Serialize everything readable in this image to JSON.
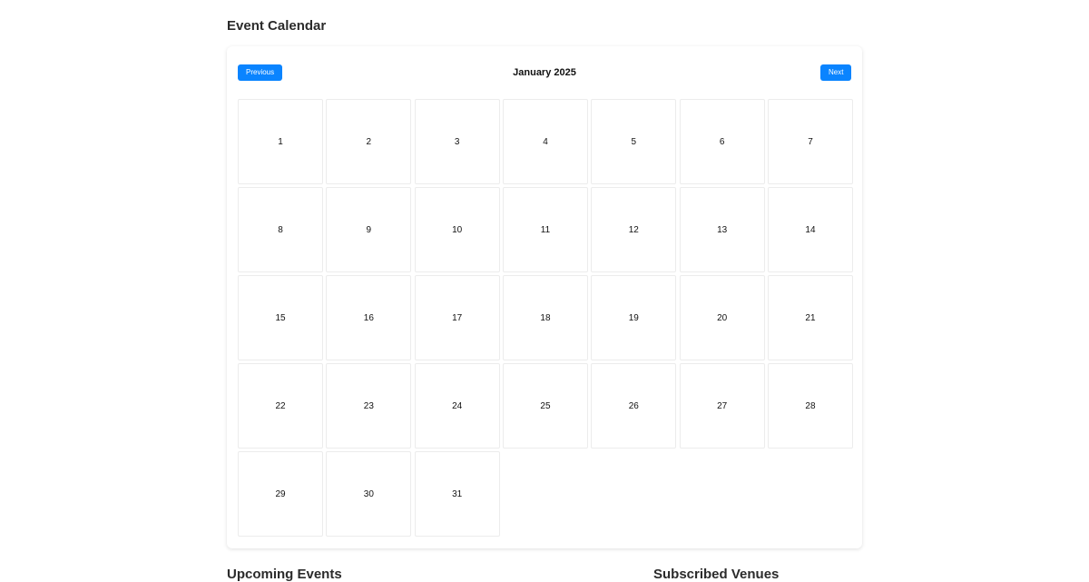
{
  "page": {
    "title": "Event Calendar"
  },
  "calendar": {
    "month_label": "January 2025",
    "prev_label": "Previous",
    "next_label": "Next",
    "days": [
      "1",
      "2",
      "3",
      "4",
      "5",
      "6",
      "7",
      "8",
      "9",
      "10",
      "11",
      "12",
      "13",
      "14",
      "15",
      "16",
      "17",
      "18",
      "19",
      "20",
      "21",
      "22",
      "23",
      "24",
      "25",
      "26",
      "27",
      "28",
      "29",
      "30",
      "31"
    ],
    "accent_color": "#0a84ff"
  },
  "sections": {
    "upcoming_title": "Upcoming Events",
    "subscribed_title": "Subscribed Venues"
  }
}
